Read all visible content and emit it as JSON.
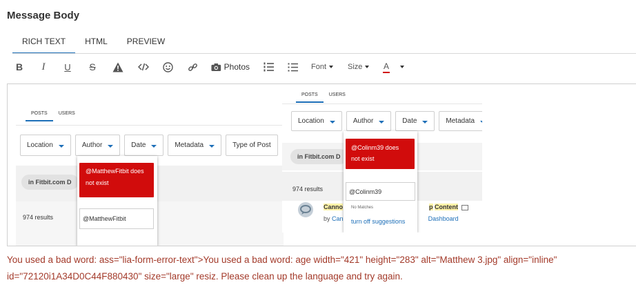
{
  "section_title": "Message Body",
  "tabs": [
    {
      "label": "RICH TEXT",
      "active": true
    },
    {
      "label": "HTML",
      "active": false
    },
    {
      "label": "PREVIEW",
      "active": false
    }
  ],
  "toolbar": {
    "bold_icon": "bold-icon",
    "italic_icon": "italic-icon",
    "underline_icon": "underline-icon",
    "strike_icon": "strikethrough-icon",
    "spoiler_icon": "warning-icon",
    "code_icon": "code-icon",
    "emoji_icon": "smiley-icon",
    "link_icon": "link-icon",
    "photos_label": "Photos",
    "ordered_list_icon": "ordered-list-icon",
    "bullet_list_icon": "bullet-list-icon",
    "font_label": "Font",
    "size_label": "Size",
    "color_label": "A",
    "text_color_accent": "#d10c0c"
  },
  "editor": {
    "shot1": {
      "tabs": [
        "POSTS",
        "USERS"
      ],
      "filters": [
        "Location",
        "Author",
        "Date",
        "Metadata",
        "Type of Post"
      ],
      "chip": "in Fitbit.com D",
      "results": "974 results",
      "error": "@MatthewFitbit does not exist",
      "input_value": "@MatthewFitbit"
    },
    "shot2": {
      "tabs": [
        "POSTS",
        "USERS"
      ],
      "filters": [
        "Location",
        "Author",
        "Date",
        "Metadata"
      ],
      "chip": "in Fitbit.com D",
      "results": "974 results",
      "error": "@Colinm39 does not exist",
      "input_value": "@Colinm39",
      "no_matches": "No Matches",
      "turn_off": "turn off suggestions",
      "post_title_start": "Canno",
      "post_title_mid": "p",
      "post_title_end": "Content",
      "post_by_prefix": "by",
      "post_by_author": "Can",
      "post_board": "Dashboard"
    }
  },
  "error_message": "You used a bad word: ass=\"lia-form-error-text\">You used a bad word: age width=\"421\" height=\"283\" alt=\"Matthew 3.jpg\" align=\"inline\" id=\"72120i1A34D0C44F880430\" size=\"large\" resiz. Please clean up the language and try again.",
  "colors": {
    "accent_blue": "#1d6fb8",
    "error_red": "#d10c0c",
    "error_text": "#a33a2a"
  }
}
